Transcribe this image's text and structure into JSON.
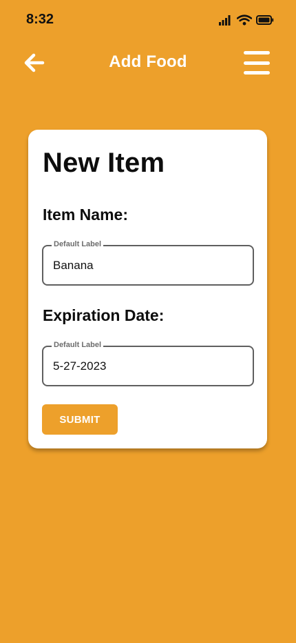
{
  "status_bar": {
    "time": "8:32",
    "icons": [
      "signal-icon",
      "wifi-icon",
      "battery-icon"
    ]
  },
  "header": {
    "title": "Add Food",
    "back_icon": "arrow-left-icon",
    "menu_icon": "hamburger-menu-icon"
  },
  "card": {
    "title": "New Item",
    "item_name": {
      "label": "Item Name:",
      "floating_label": "Default Label",
      "value": "Banana"
    },
    "expiration_date": {
      "label": "Expiration Date:",
      "floating_label": "Default Label",
      "value": "5-27-2023"
    },
    "submit_label": "SUBMIT"
  },
  "colors": {
    "background": "#EDA02B",
    "card": "#FFFFFF",
    "button": "#EDA02B",
    "text": "#0D0D0D"
  }
}
